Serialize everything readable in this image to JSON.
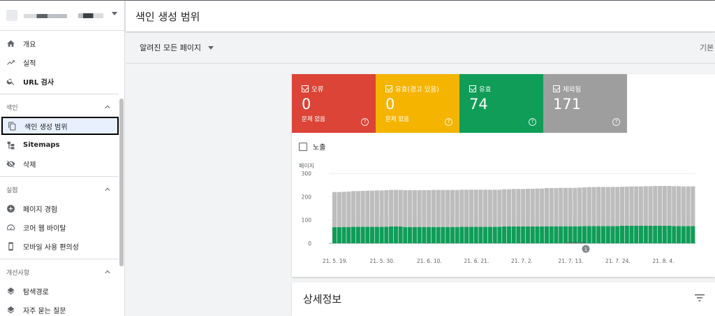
{
  "sidebar": {
    "items_top": [
      {
        "label": "개요",
        "icon": "home-icon"
      },
      {
        "label": "실적",
        "icon": "trending-icon"
      },
      {
        "label": "URL 검사",
        "icon": "search-icon"
      }
    ],
    "section_index": "색인",
    "items_index": [
      {
        "label": "색인 생성 범위",
        "icon": "copy-icon"
      },
      {
        "label": "Sitemaps",
        "icon": "sitemap-icon"
      },
      {
        "label": "삭제",
        "icon": "hidden-eye-icon"
      }
    ],
    "section_experience": "실험",
    "items_experience": [
      {
        "label": "페이지 경험",
        "icon": "plus-circle-icon"
      },
      {
        "label": "코어 웹 바이탈",
        "icon": "speedometer-icon"
      },
      {
        "label": "모바일 사용 편의성",
        "icon": "phone-icon"
      }
    ],
    "section_enhancements": "개선사항",
    "items_enhancements": [
      {
        "label": "탐색경로",
        "icon": "layers-icon"
      },
      {
        "label": "자주 묻는 질문",
        "icon": "layers-icon"
      }
    ]
  },
  "header": {
    "title": "색인 생성 범위"
  },
  "filter": {
    "label": "알려진 모든 페이지",
    "right_text": "기본"
  },
  "tiles": [
    {
      "label": "오류",
      "value": "0",
      "sub": "문제 없음",
      "color": "#db4437"
    },
    {
      "label": "유효(경고 있음)",
      "value": "0",
      "sub": "문제 없음",
      "color": "#f4b400"
    },
    {
      "label": "유효",
      "value": "74",
      "sub": "",
      "color": "#0f9d58"
    },
    {
      "label": "제외됨",
      "value": "171",
      "sub": "",
      "color": "#9e9e9e"
    }
  ],
  "impressions_label": "노출",
  "chart_data": {
    "type": "bar",
    "stacked": true,
    "ylabel": "페이지",
    "ylim": [
      0,
      300
    ],
    "yticks": [
      0,
      100,
      200,
      300
    ],
    "x_tick_labels": [
      "21. 5. 19.",
      "21. 5. 30.",
      "21. 6. 10.",
      "21. 6. 21.",
      "21. 7. 2.",
      "21. 7. 13.",
      "21. 7. 24.",
      "21. 8. 4."
    ],
    "annotation": "1",
    "series": [
      {
        "color": "#0f9d58",
        "values": [
          69,
          69,
          70,
          70,
          71,
          71,
          71,
          71,
          71,
          71,
          71,
          71,
          72,
          72,
          72,
          70,
          70,
          70,
          70,
          70,
          70,
          70,
          70,
          70,
          70,
          70,
          70,
          71,
          71,
          71,
          71,
          71,
          71,
          71,
          71,
          71,
          72,
          72,
          72,
          72,
          72,
          72,
          72,
          72,
          72,
          73,
          73,
          73,
          73,
          73,
          73,
          73,
          73,
          74,
          74,
          74,
          74,
          74,
          74,
          74,
          74,
          75,
          75,
          75,
          75,
          75,
          75,
          75,
          75,
          75,
          75,
          75,
          74,
          74,
          74,
          74,
          74
        ]
      },
      {
        "color": "#bdbdbd",
        "values": [
          151,
          151,
          151,
          152,
          153,
          153,
          154,
          155,
          155,
          156,
          156,
          157,
          157,
          157,
          157,
          158,
          158,
          158,
          158,
          158,
          158,
          159,
          159,
          159,
          159,
          159,
          159,
          159,
          159,
          159,
          159,
          159,
          159,
          159,
          159,
          159,
          160,
          160,
          161,
          161,
          161,
          162,
          162,
          163,
          163,
          164,
          164,
          164,
          165,
          165,
          165,
          165,
          166,
          166,
          167,
          167,
          168,
          168,
          168,
          168,
          168,
          168,
          168,
          169,
          169,
          169,
          170,
          170,
          171,
          171,
          171,
          171,
          171,
          171,
          170,
          170,
          170
        ]
      }
    ]
  },
  "details": {
    "title": "상세정보"
  }
}
